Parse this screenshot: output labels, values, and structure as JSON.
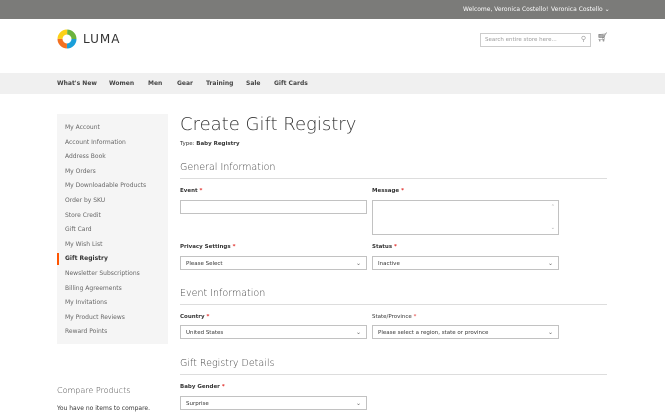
{
  "header": {
    "welcome": "Welcome, Veronica Costello!",
    "account": "Veronica Costello",
    "logo": "LUMA",
    "search_placeholder": "Search entire store here..."
  },
  "nav": [
    "What's New",
    "Women",
    "Men",
    "Gear",
    "Training",
    "Sale",
    "Gift Cards"
  ],
  "sidebar": {
    "items": [
      "My Account",
      "Account Information",
      "Address Book",
      "My Orders",
      "My Downloadable Products",
      "Order by SKU",
      "Store Credit",
      "Gift Card",
      "My Wish List",
      "Gift Registry",
      "Newsletter Subscriptions",
      "Billing Agreements",
      "My Invitations",
      "My Product Reviews",
      "Reward Points"
    ],
    "active": "Gift Registry"
  },
  "compare": {
    "title": "Compare Products",
    "empty": "You have no items to compare."
  },
  "page": {
    "title": "Create Gift Registry",
    "type_label": "Type:",
    "type_value": "Baby Registry"
  },
  "sections": {
    "general": "General Information",
    "event": "Event Information",
    "details": "Gift Registry Details"
  },
  "fields": {
    "event": {
      "label": "Event",
      "value": ""
    },
    "message": {
      "label": "Message",
      "value": ""
    },
    "privacy": {
      "label": "Privacy Settings",
      "value": "Please Select"
    },
    "status": {
      "label": "Status",
      "value": "Inactive"
    },
    "country": {
      "label": "Country",
      "value": "United States"
    },
    "state": {
      "label": "State/Province",
      "value": "Please select a region, state or province"
    },
    "gender": {
      "label": "Baby Gender",
      "value": "Surprise"
    }
  },
  "colors": {
    "accent": "#ff5501",
    "required": "#e02b27"
  }
}
